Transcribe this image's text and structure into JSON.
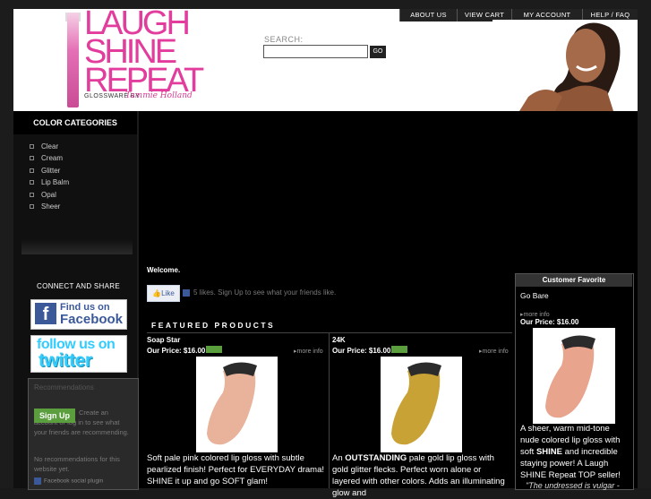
{
  "header": {
    "logo_words": [
      "LAUGH",
      "SHINE",
      "REPEAT"
    ],
    "logo_sub": "GLOSSWARE BY",
    "logo_signature": "Tammie Holland",
    "search_label": "SEARCH:",
    "search_placeholder": "",
    "search_button": "GO"
  },
  "topnav": [
    {
      "label": "ABOUT US"
    },
    {
      "label": "VIEW CART"
    },
    {
      "label": "MY ACCOUNT"
    },
    {
      "label": "HELP / FAQ"
    }
  ],
  "sidebar": {
    "title": "COLOR CATEGORIES",
    "items": [
      {
        "label": "Clear"
      },
      {
        "label": "Cream"
      },
      {
        "label": "Glitter"
      },
      {
        "label": "Lip Balm"
      },
      {
        "label": "Opal"
      },
      {
        "label": "Sheer"
      }
    ],
    "connect_label": "CONNECT AND SHARE",
    "facebook": {
      "line1": "Find us on",
      "line2": "Facebook"
    },
    "twitter": {
      "line1": "follow us on",
      "line2": "twitter"
    }
  },
  "recommendations": {
    "title": "Recommendations",
    "signup": "Sign Up",
    "text": "Create an account or log in to see what your friends are recommending.",
    "none": "No recommendations for this website yet.",
    "plugin": "Facebook social plugin"
  },
  "main": {
    "welcome": "Welcome.",
    "like_label": "Like",
    "like_text": "5 likes. Sign Up to see what your friends like.",
    "featured_title": "FEATURED PRODUCTS",
    "products": [
      {
        "name": "Soap Star",
        "price": "Our Price: $16.00",
        "more": "more info",
        "description": "Soft pale pink colored lip gloss with subtle pearlized finish! Perfect for EVERYDAY drama! SHINE it up and go SOFT glam!",
        "swatch_color": "#e9b39b"
      },
      {
        "name": "24K",
        "price": "Our Price: $16.00",
        "more": "more info",
        "description_bold": "OUTSTANDING",
        "description_pre": "An",
        "description": "pale gold lip gloss with gold glitter flecks. Perfect worn alone or layered with other colors. Adds an illuminating glow and",
        "swatch_color": "#c9a235"
      }
    ]
  },
  "customer_favorite": {
    "title": "Customer Favorite",
    "name": "Go Bare",
    "more": "more info",
    "price": "Our Price: $16.00",
    "description_pre": "A sheer, warm mid-tone nude colored lip gloss with soft",
    "description_bold": "SHINE",
    "description_post": "and incredible staying power!  A Laugh SHINE Repeat TOP seller!",
    "quote": "\"The undressed is vulgar -",
    "swatch_color": "#e8a48c"
  },
  "colors": {
    "accent_pink": "#e23c9d",
    "signup_green": "#5a9e3e",
    "facebook_blue": "#3b5998",
    "twitter_blue": "#33ccff"
  }
}
